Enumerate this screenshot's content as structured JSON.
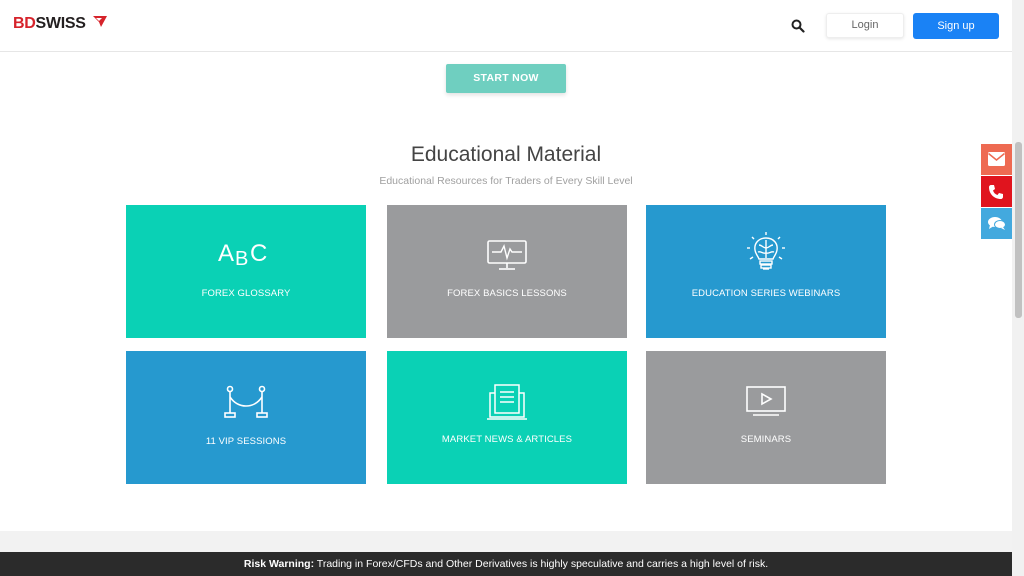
{
  "header": {
    "logo_bd": "BD",
    "logo_swiss": "SWISS",
    "login_label": "Login",
    "signup_label": "Sign up"
  },
  "hero": {
    "start_label": "START NOW"
  },
  "section": {
    "title": "Educational Material",
    "subtitle": "Educational Resources for Traders of Every Skill Level"
  },
  "cards": [
    {
      "label": "FOREX GLOSSARY",
      "icon": "abc-icon",
      "color": "#0ad1b5",
      "icon_text": "ABC"
    },
    {
      "label": "FOREX BASICS LESSONS",
      "icon": "monitor-pulse-icon",
      "color": "#9a9b9d"
    },
    {
      "label": "EDUCATION SERIES WEBINARS",
      "icon": "brain-bulb-icon",
      "color": "#2699cf"
    },
    {
      "label": "1⁠1 VIP SESSIONS",
      "icon": "velvet-rope-icon",
      "color": "#2699cf"
    },
    {
      "label": "MARKET NEWS & ARTICLES",
      "icon": "news-icon",
      "color": "#0ad1b5"
    },
    {
      "label": "SEMINARS",
      "icon": "video-play-icon",
      "color": "#9a9b9d"
    }
  ],
  "contact": [
    "mail-icon",
    "phone-icon",
    "chat-icon"
  ],
  "risk": {
    "title": "Risk Warning:",
    "text": " Trading in Forex/CFDs and Other Derivatives is highly speculative and carries a high level of risk."
  },
  "colors": {
    "brand_red": "#d6232b",
    "signup_blue": "#1a82f5",
    "start_teal": "#6fcfc0",
    "teal": "#0ad1b5",
    "gray": "#9a9b9d",
    "blue": "#2699cf"
  }
}
